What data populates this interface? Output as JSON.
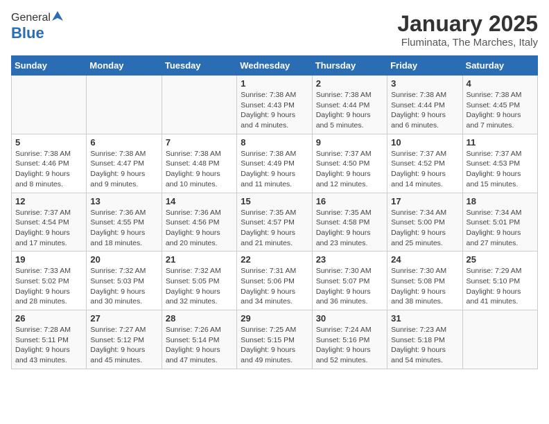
{
  "header": {
    "logo_general": "General",
    "logo_blue": "Blue",
    "title": "January 2025",
    "subtitle": "Fluminata, The Marches, Italy"
  },
  "days_of_week": [
    "Sunday",
    "Monday",
    "Tuesday",
    "Wednesday",
    "Thursday",
    "Friday",
    "Saturday"
  ],
  "weeks": [
    [
      {
        "day": "",
        "info": ""
      },
      {
        "day": "",
        "info": ""
      },
      {
        "day": "",
        "info": ""
      },
      {
        "day": "1",
        "info": "Sunrise: 7:38 AM\nSunset: 4:43 PM\nDaylight: 9 hours\nand 4 minutes."
      },
      {
        "day": "2",
        "info": "Sunrise: 7:38 AM\nSunset: 4:44 PM\nDaylight: 9 hours\nand 5 minutes."
      },
      {
        "day": "3",
        "info": "Sunrise: 7:38 AM\nSunset: 4:44 PM\nDaylight: 9 hours\nand 6 minutes."
      },
      {
        "day": "4",
        "info": "Sunrise: 7:38 AM\nSunset: 4:45 PM\nDaylight: 9 hours\nand 7 minutes."
      }
    ],
    [
      {
        "day": "5",
        "info": "Sunrise: 7:38 AM\nSunset: 4:46 PM\nDaylight: 9 hours\nand 8 minutes."
      },
      {
        "day": "6",
        "info": "Sunrise: 7:38 AM\nSunset: 4:47 PM\nDaylight: 9 hours\nand 9 minutes."
      },
      {
        "day": "7",
        "info": "Sunrise: 7:38 AM\nSunset: 4:48 PM\nDaylight: 9 hours\nand 10 minutes."
      },
      {
        "day": "8",
        "info": "Sunrise: 7:38 AM\nSunset: 4:49 PM\nDaylight: 9 hours\nand 11 minutes."
      },
      {
        "day": "9",
        "info": "Sunrise: 7:37 AM\nSunset: 4:50 PM\nDaylight: 9 hours\nand 12 minutes."
      },
      {
        "day": "10",
        "info": "Sunrise: 7:37 AM\nSunset: 4:52 PM\nDaylight: 9 hours\nand 14 minutes."
      },
      {
        "day": "11",
        "info": "Sunrise: 7:37 AM\nSunset: 4:53 PM\nDaylight: 9 hours\nand 15 minutes."
      }
    ],
    [
      {
        "day": "12",
        "info": "Sunrise: 7:37 AM\nSunset: 4:54 PM\nDaylight: 9 hours\nand 17 minutes."
      },
      {
        "day": "13",
        "info": "Sunrise: 7:36 AM\nSunset: 4:55 PM\nDaylight: 9 hours\nand 18 minutes."
      },
      {
        "day": "14",
        "info": "Sunrise: 7:36 AM\nSunset: 4:56 PM\nDaylight: 9 hours\nand 20 minutes."
      },
      {
        "day": "15",
        "info": "Sunrise: 7:35 AM\nSunset: 4:57 PM\nDaylight: 9 hours\nand 21 minutes."
      },
      {
        "day": "16",
        "info": "Sunrise: 7:35 AM\nSunset: 4:58 PM\nDaylight: 9 hours\nand 23 minutes."
      },
      {
        "day": "17",
        "info": "Sunrise: 7:34 AM\nSunset: 5:00 PM\nDaylight: 9 hours\nand 25 minutes."
      },
      {
        "day": "18",
        "info": "Sunrise: 7:34 AM\nSunset: 5:01 PM\nDaylight: 9 hours\nand 27 minutes."
      }
    ],
    [
      {
        "day": "19",
        "info": "Sunrise: 7:33 AM\nSunset: 5:02 PM\nDaylight: 9 hours\nand 28 minutes."
      },
      {
        "day": "20",
        "info": "Sunrise: 7:32 AM\nSunset: 5:03 PM\nDaylight: 9 hours\nand 30 minutes."
      },
      {
        "day": "21",
        "info": "Sunrise: 7:32 AM\nSunset: 5:05 PM\nDaylight: 9 hours\nand 32 minutes."
      },
      {
        "day": "22",
        "info": "Sunrise: 7:31 AM\nSunset: 5:06 PM\nDaylight: 9 hours\nand 34 minutes."
      },
      {
        "day": "23",
        "info": "Sunrise: 7:30 AM\nSunset: 5:07 PM\nDaylight: 9 hours\nand 36 minutes."
      },
      {
        "day": "24",
        "info": "Sunrise: 7:30 AM\nSunset: 5:08 PM\nDaylight: 9 hours\nand 38 minutes."
      },
      {
        "day": "25",
        "info": "Sunrise: 7:29 AM\nSunset: 5:10 PM\nDaylight: 9 hours\nand 41 minutes."
      }
    ],
    [
      {
        "day": "26",
        "info": "Sunrise: 7:28 AM\nSunset: 5:11 PM\nDaylight: 9 hours\nand 43 minutes."
      },
      {
        "day": "27",
        "info": "Sunrise: 7:27 AM\nSunset: 5:12 PM\nDaylight: 9 hours\nand 45 minutes."
      },
      {
        "day": "28",
        "info": "Sunrise: 7:26 AM\nSunset: 5:14 PM\nDaylight: 9 hours\nand 47 minutes."
      },
      {
        "day": "29",
        "info": "Sunrise: 7:25 AM\nSunset: 5:15 PM\nDaylight: 9 hours\nand 49 minutes."
      },
      {
        "day": "30",
        "info": "Sunrise: 7:24 AM\nSunset: 5:16 PM\nDaylight: 9 hours\nand 52 minutes."
      },
      {
        "day": "31",
        "info": "Sunrise: 7:23 AM\nSunset: 5:18 PM\nDaylight: 9 hours\nand 54 minutes."
      },
      {
        "day": "",
        "info": ""
      }
    ]
  ]
}
